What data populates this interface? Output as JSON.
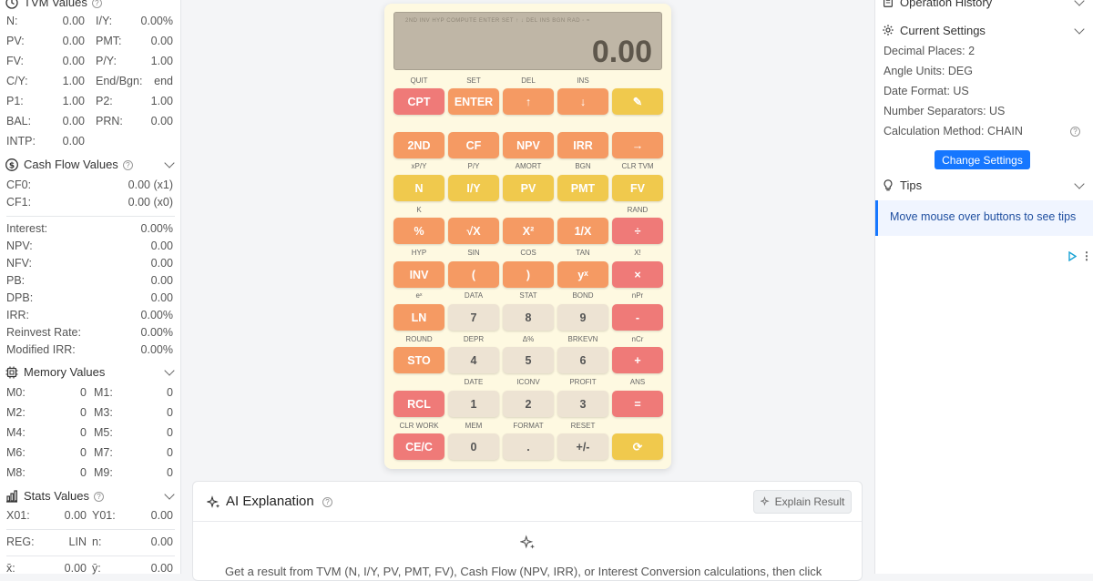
{
  "left": {
    "tvm": {
      "title": "TVM Values",
      "rows": [
        [
          "N:",
          "0.00",
          "I/Y:",
          "0.00%"
        ],
        [
          "PV:",
          "0.00",
          "PMT:",
          "0.00"
        ],
        [
          "FV:",
          "0.00",
          "P/Y:",
          "1.00"
        ],
        [
          "C/Y:",
          "1.00",
          "End/Bgn:",
          "end"
        ],
        [
          "P1:",
          "1.00",
          "P2:",
          "1.00"
        ],
        [
          "BAL:",
          "0.00",
          "PRN:",
          "0.00"
        ],
        [
          "INTP:",
          "0.00",
          "",
          ""
        ]
      ]
    },
    "cashflow": {
      "title": "Cash Flow Values",
      "cf": [
        [
          "CF0:",
          "0.00 (x1)"
        ],
        [
          "CF1:",
          "0.00 (x0)"
        ]
      ],
      "metrics": [
        [
          "Interest:",
          "0.00%"
        ],
        [
          "NPV:",
          "0.00"
        ],
        [
          "NFV:",
          "0.00"
        ],
        [
          "PB:",
          "0.00"
        ],
        [
          "DPB:",
          "0.00"
        ],
        [
          "IRR:",
          "0.00%"
        ],
        [
          "Reinvest Rate:",
          "0.00%"
        ],
        [
          "Modified IRR:",
          "0.00%"
        ]
      ]
    },
    "memory": {
      "title": "Memory Values",
      "rows": [
        [
          "M0:",
          "0",
          "M1:",
          "0"
        ],
        [
          "M2:",
          "0",
          "M3:",
          "0"
        ],
        [
          "M4:",
          "0",
          "M5:",
          "0"
        ],
        [
          "M6:",
          "0",
          "M7:",
          "0"
        ],
        [
          "M8:",
          "0",
          "M9:",
          "0"
        ]
      ]
    },
    "stats": {
      "title": "Stats Values",
      "rows": [
        [
          "X01:",
          "0.00",
          "Y01:",
          "0.00"
        ],
        [
          "REG:",
          "LIN",
          "n:",
          "0.00"
        ],
        [
          "x̄:",
          "0.00",
          "ȳ:",
          "0.00"
        ]
      ]
    }
  },
  "calculator": {
    "display_value": "0.00",
    "indicators": "2ND  INV  HYP  COMPUTE  ENTER  SET  ↑  ↓  DEL  INS  BGN  RAD  ◦  ≈",
    "rows": [
      {
        "labels": [
          "QUIT",
          "SET",
          "DEL",
          "INS",
          ""
        ],
        "keys": [
          [
            "CPT",
            "red"
          ],
          [
            "ENTER",
            "or"
          ],
          [
            "↑",
            "or"
          ],
          [
            "↓",
            "or"
          ],
          [
            "✎",
            "yel"
          ]
        ]
      },
      {
        "labels": [
          "",
          "",
          "",
          "",
          ""
        ],
        "keys": [
          [
            "2ND",
            "or"
          ],
          [
            "CF",
            "or"
          ],
          [
            "NPV",
            "or"
          ],
          [
            "IRR",
            "or"
          ],
          [
            "→",
            "or"
          ]
        ]
      },
      {
        "labels": [
          "xP/Y",
          "P/Y",
          "AMORT",
          "BGN",
          "CLR TVM"
        ],
        "keys": [
          [
            "N",
            "yel"
          ],
          [
            "I/Y",
            "yel"
          ],
          [
            "PV",
            "yel"
          ],
          [
            "PMT",
            "yel"
          ],
          [
            "FV",
            "yel"
          ]
        ]
      },
      {
        "labels": [
          "K",
          "",
          "",
          "",
          "RAND"
        ],
        "keys": [
          [
            "%",
            "or"
          ],
          [
            "√X",
            "or"
          ],
          [
            "X²",
            "or"
          ],
          [
            "1/X",
            "or"
          ],
          [
            "÷",
            "red"
          ]
        ]
      },
      {
        "labels": [
          "HYP",
          "SIN",
          "COS",
          "TAN",
          "X!"
        ],
        "keys": [
          [
            "INV",
            "or"
          ],
          [
            "(",
            "or"
          ],
          [
            ")",
            "or"
          ],
          [
            "yˣ",
            "or"
          ],
          [
            "×",
            "red"
          ]
        ]
      },
      {
        "labels": [
          "eˣ",
          "DATA",
          "STAT",
          "BOND",
          "nPr"
        ],
        "keys": [
          [
            "LN",
            "or"
          ],
          [
            "7",
            "num"
          ],
          [
            "8",
            "num"
          ],
          [
            "9",
            "num"
          ],
          [
            "-",
            "red"
          ]
        ]
      },
      {
        "labels": [
          "ROUND",
          "DEPR",
          "Δ%",
          "BRKEVN",
          "nCr"
        ],
        "keys": [
          [
            "STO",
            "or"
          ],
          [
            "4",
            "num"
          ],
          [
            "5",
            "num"
          ],
          [
            "6",
            "num"
          ],
          [
            "+",
            "red"
          ]
        ]
      },
      {
        "labels": [
          "",
          "DATE",
          "ICONV",
          "PROFIT",
          "ANS"
        ],
        "keys": [
          [
            "RCL",
            "red"
          ],
          [
            "1",
            "num"
          ],
          [
            "2",
            "num"
          ],
          [
            "3",
            "num"
          ],
          [
            "=",
            "red"
          ]
        ]
      },
      {
        "labels": [
          "CLR WORK",
          "MEM",
          "FORMAT",
          "RESET",
          ""
        ],
        "keys": [
          [
            "CE/C",
            "red"
          ],
          [
            "0",
            "num"
          ],
          [
            ".",
            "num"
          ],
          [
            "+/-",
            "num"
          ],
          [
            "⟳",
            "yel"
          ]
        ]
      }
    ]
  },
  "ai": {
    "title": "AI Explanation",
    "button": "Explain Result",
    "message": "Get a result from TVM (N, I/Y, PV, PMT, FV), Cash Flow (NPV, IRR), or Interest Conversion calculations, then click"
  },
  "right": {
    "history_title": "Operation History",
    "settings_title": "Current Settings",
    "settings": [
      "Decimal Places: 2",
      "Angle Units: DEG",
      "Date Format: US",
      "Number Separators: US",
      "Calculation Method: CHAIN"
    ],
    "change_button": "Change Settings",
    "tips_title": "Tips",
    "tip_text": "Move mouse over buttons to see tips"
  },
  "colors": {
    "red": "#ef7a78",
    "orange": "#f59a63",
    "yellow": "#f0c94d",
    "number": "#ede3d3",
    "accent": "#1677ff"
  }
}
